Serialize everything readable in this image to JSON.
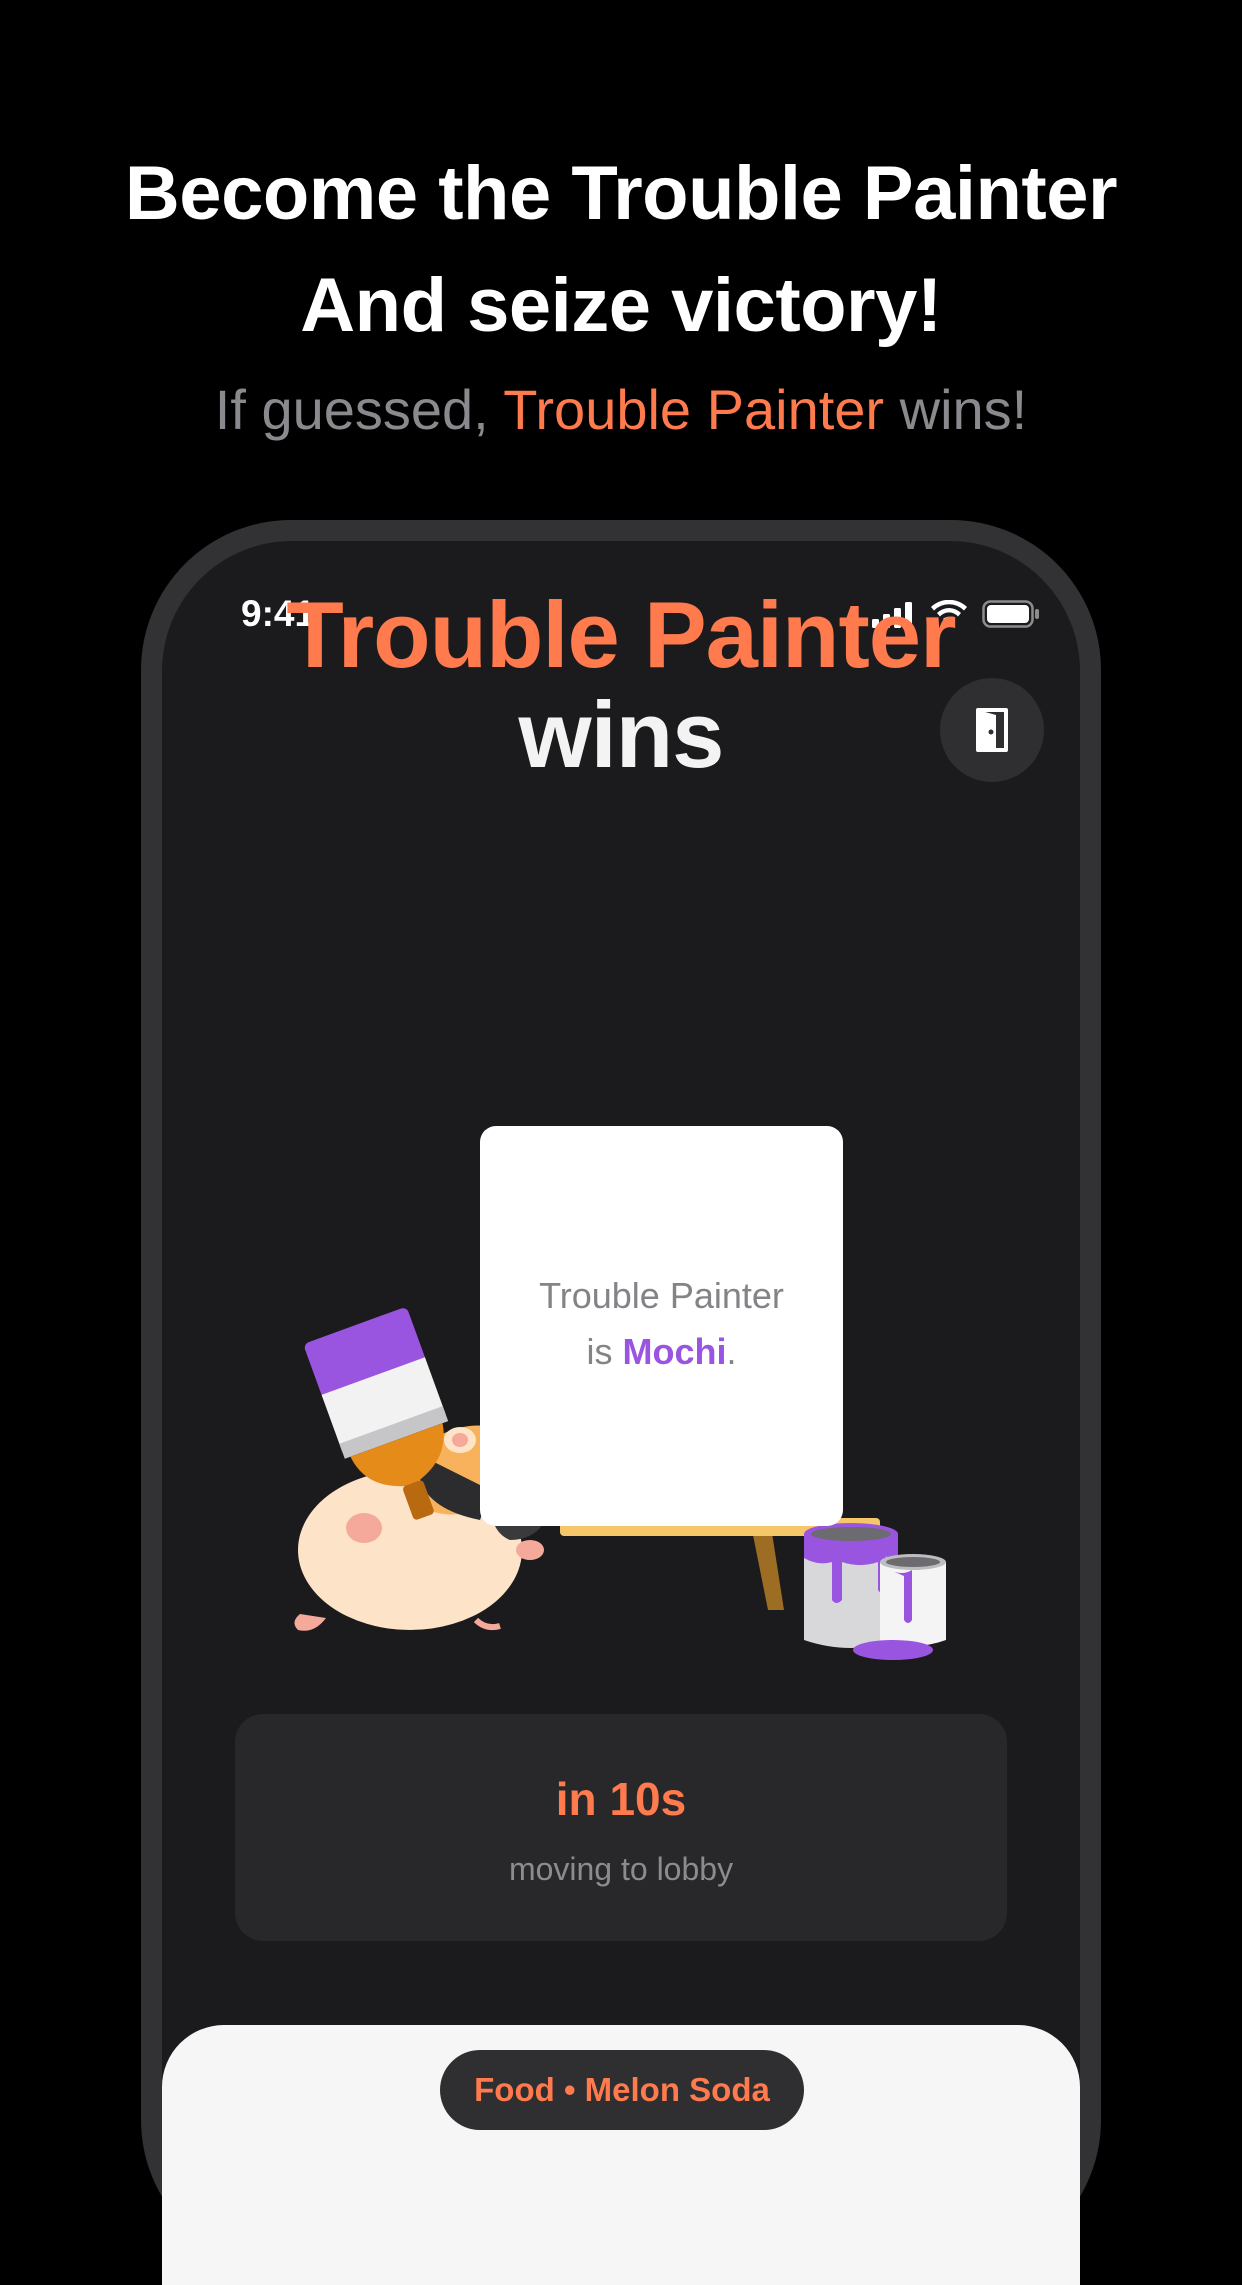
{
  "headline": {
    "line1": "Become the Trouble Painter",
    "line2": "And seize victory!"
  },
  "subline": {
    "prefix": "If guessed,",
    "accent": "Trouble Painter",
    "suffix": "wins!"
  },
  "status_bar": {
    "time": "9:41",
    "icons": [
      "signal-icon",
      "wifi-icon",
      "battery-icon"
    ]
  },
  "exit_button": {
    "icon": "exit-door-icon"
  },
  "result": {
    "title_accent": "Trouble Painter",
    "title_rest": "wins"
  },
  "card": {
    "line1": "Trouble Painter",
    "line2_prefix": "is",
    "name": "Mochi",
    "line2_suffix": "."
  },
  "countdown": {
    "main": "in 10s",
    "sub": "moving to lobby"
  },
  "topic": {
    "label": "Food • Melon Soda"
  },
  "colors": {
    "accent": "#ff7a4d",
    "purple": "#9a55e0",
    "background": "#000000",
    "screen": "#1b1b1d"
  }
}
